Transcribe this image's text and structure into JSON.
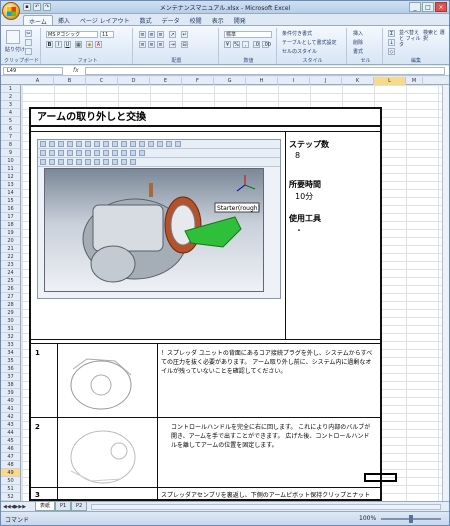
{
  "window": {
    "title": "メンテナンスマニュアル.xlsx - Microsoft Excel"
  },
  "ribbon": {
    "tabs": [
      "ホーム",
      "挿入",
      "ページ レイアウト",
      "数式",
      "データ",
      "校閲",
      "表示",
      "開発"
    ],
    "font_name": "MS Pゴシック",
    "font_size": "11",
    "number_format": "標準",
    "groups": [
      "クリップボード",
      "フォント",
      "配置",
      "数値",
      "スタイル",
      "セル",
      "編集"
    ],
    "paste_label": "貼り付け",
    "cond_format": "条件付き書式",
    "table_format": "テーブルとして書式設定",
    "cell_styles": "セルのスタイル",
    "insert_label": "挿入",
    "delete_label": "削除",
    "format_label": "書式",
    "sort_label": "並べ替えと フィルタ",
    "find_label": "検索と 選択"
  },
  "formula_bar": {
    "name_box": "L49",
    "fx": "fx",
    "value": ""
  },
  "grid": {
    "columns": [
      "A",
      "B",
      "C",
      "D",
      "E",
      "F",
      "G",
      "H",
      "I",
      "J",
      "K",
      "L",
      "M"
    ],
    "selected_column": "L",
    "selected_row": "49",
    "rows": [
      "1",
      "2",
      "3",
      "4",
      "5",
      "6",
      "7",
      "8",
      "9",
      "10",
      "11",
      "12",
      "13",
      "14",
      "15",
      "16",
      "17",
      "18",
      "19",
      "20",
      "21",
      "22",
      "23",
      "24",
      "25",
      "26",
      "27",
      "28",
      "29",
      "30",
      "31",
      "32",
      "33",
      "34",
      "35",
      "36",
      "37",
      "38",
      "39",
      "40",
      "41",
      "42",
      "43",
      "44",
      "45",
      "46",
      "47",
      "48",
      "49",
      "50",
      "51",
      "52"
    ]
  },
  "document": {
    "title": "アームの取り外しと交換",
    "step_count_label": "ステップ数",
    "step_count_value": "8",
    "time_label": "所要時間",
    "time_value": "10分",
    "tools_label": "使用工具",
    "tools_value": "・",
    "callout": "Starter(rough)",
    "steps": [
      {
        "num": "1",
        "text": "！スプレッダ ユニットの背面にあるコア接続プラグを外し、システムからすべての圧力を抜く必要があります。 アーム取り外し前に、システム内に過剰なオイルが残っていないことを確認してください。"
      },
      {
        "num": "2",
        "text": "コントロールハンドルを完全に右に回します。 これにより内部のバルブが開き、アームを手で出すことができます。 広げた後、コントロールハンドルを離してアームの位置を固定します。"
      },
      {
        "num": "3",
        "text": "スプレッダアセンブリを裏返し、下側のアームピボット保持クリップとナットが見えるようにします。 ラジオペンチあるいはクリップ外し用工具を使って保持クリップを外します。 メインピボットピンのナットを外"
      }
    ]
  },
  "sheet_tabs": [
    "表紙",
    "P1",
    "P2"
  ],
  "status": {
    "ready": "コマンド",
    "zoom": "100%"
  }
}
